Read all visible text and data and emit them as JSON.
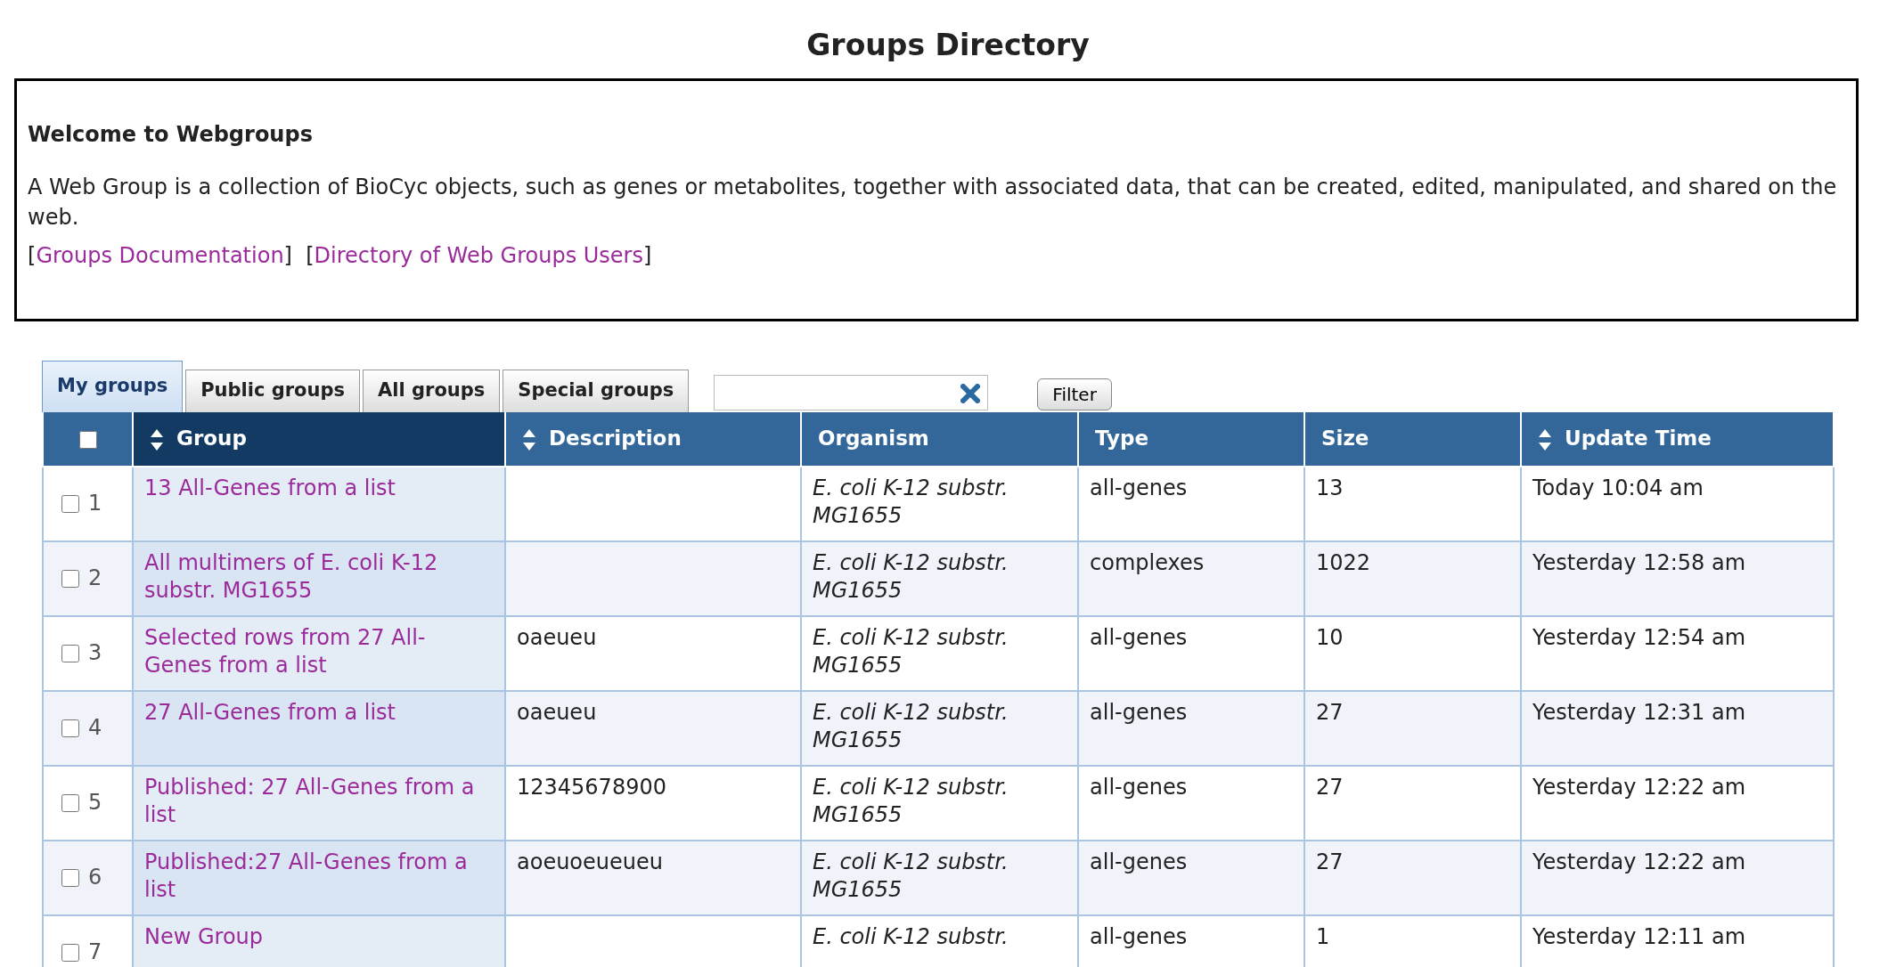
{
  "title": "Groups Directory",
  "intro": {
    "heading": "Welcome to Webgroups",
    "text": "A Web Group is a collection of BioCyc objects, such as genes or metabolites, together with associated data, that can be created, edited, manipulated, and shared on the web.",
    "links": [
      {
        "open": "[",
        "label": "Groups Documentation",
        "close": "]"
      },
      {
        "open": "[",
        "label": "Directory of Web Groups Users",
        "close": "]"
      }
    ]
  },
  "tabs": [
    {
      "label": "My groups",
      "selected": true
    },
    {
      "label": "Public groups",
      "selected": false
    },
    {
      "label": "All groups",
      "selected": false
    },
    {
      "label": "Special groups",
      "selected": false
    }
  ],
  "filter_button": "Filter",
  "table": {
    "select_all_checked": false,
    "columns": [
      {
        "label": "Group",
        "sortable": true,
        "sorted": true
      },
      {
        "label": "Description",
        "sortable": true,
        "sorted": false
      },
      {
        "label": "Organism",
        "sortable": false,
        "sorted": false
      },
      {
        "label": "Type",
        "sortable": false,
        "sorted": false
      },
      {
        "label": "Size",
        "sortable": false,
        "sorted": false
      },
      {
        "label": "Update Time",
        "sortable": true,
        "sorted": false
      }
    ],
    "rows": [
      {
        "number": "1",
        "checked": false,
        "group": "13 All-Genes from a list",
        "description": "",
        "organism": [
          "E. coli K-12 substr.",
          "MG1655"
        ],
        "type": "all-genes",
        "size": "13",
        "updated": "Today 10:04 am"
      },
      {
        "number": "2",
        "checked": false,
        "group": "All multimers of E. coli K-12 substr. MG1655",
        "description": "",
        "organism": [
          "E. coli K-12 substr.",
          "MG1655"
        ],
        "type": "complexes",
        "size": "1022",
        "updated": "Yesterday 12:58 am"
      },
      {
        "number": "3",
        "checked": false,
        "group": "Selected rows from 27 All-Genes from a list",
        "description": "oaeueu",
        "organism": [
          "E. coli K-12 substr.",
          "MG1655"
        ],
        "type": "all-genes",
        "size": "10",
        "updated": "Yesterday 12:54 am"
      },
      {
        "number": "4",
        "checked": false,
        "group": "27 All-Genes from a list",
        "description": "oaeueu",
        "organism": [
          "E. coli K-12 substr.",
          "MG1655"
        ],
        "type": "all-genes",
        "size": "27",
        "updated": "Yesterday 12:31 am"
      },
      {
        "number": "5",
        "checked": false,
        "group": "Published: 27 All-Genes from a list",
        "description": "12345678900",
        "organism": [
          "E. coli K-12 substr.",
          "MG1655"
        ],
        "type": "all-genes",
        "size": "27",
        "updated": "Yesterday 12:22 am"
      },
      {
        "number": "6",
        "checked": false,
        "group": "Published:27 All-Genes from a list",
        "description": "aoeuoeueueu",
        "organism": [
          "E. coli K-12 substr.",
          "MG1655"
        ],
        "type": "all-genes",
        "size": "27",
        "updated": "Yesterday 12:22 am"
      },
      {
        "number": "7",
        "checked": false,
        "group": "New Group",
        "description": "",
        "organism": [
          "E. coli K-12 substr."
        ],
        "type": "all-genes",
        "size": "1",
        "updated": "Yesterday 12:11 am"
      }
    ]
  }
}
